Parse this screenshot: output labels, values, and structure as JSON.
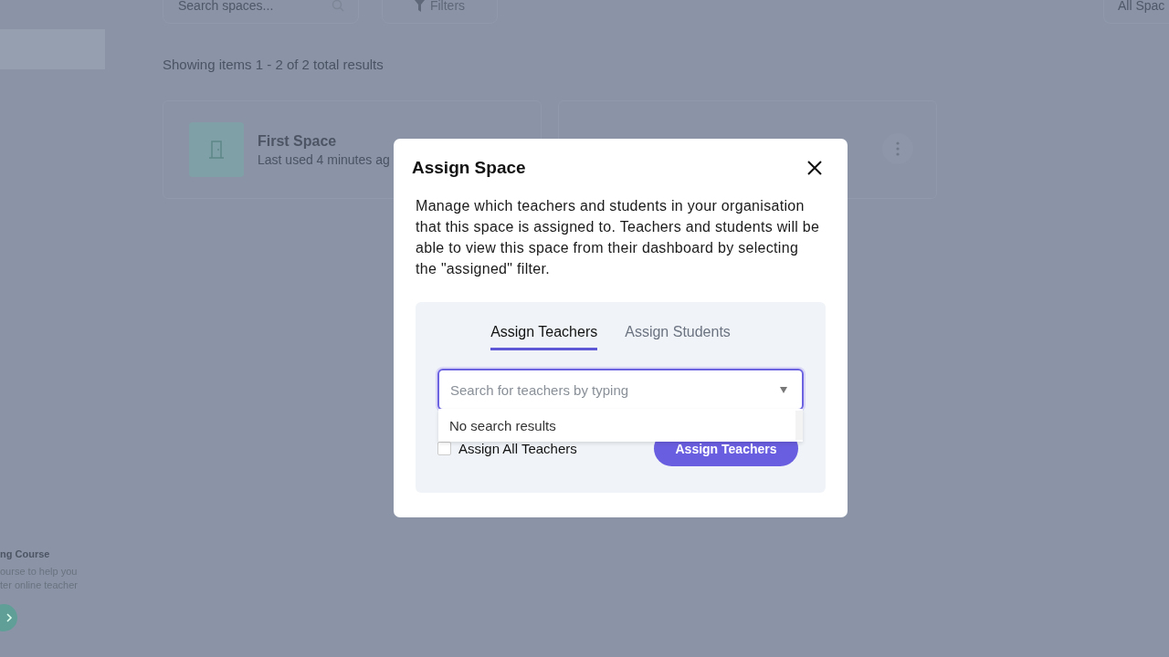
{
  "page": {
    "search": {
      "placeholder": "Search spaces..."
    },
    "filters_button": "Filters",
    "view_select": "All Spac",
    "results_summary": "Showing items 1 - 2 of 2 total results",
    "spaces": [
      {
        "kind": "named",
        "title": "First Space",
        "subtitle": "Last used 4 minutes ag"
      },
      {
        "kind": "covered"
      }
    ],
    "sidebar_promo": {
      "title": "ng Course",
      "lines": [
        "ourse to help you",
        "ter online teacher"
      ]
    }
  },
  "modal": {
    "title": "Assign Space",
    "description": "Manage which teachers and students in your organisation that this space is assigned to. Teachers and students will be able to view this space from their dashboard by selecting the \"assigned\" filter.",
    "tabs": [
      {
        "label": "Assign Teachers",
        "selected": true
      },
      {
        "label": "Assign Students",
        "selected": false
      }
    ],
    "search": {
      "placeholder": "Search for teachers by typing"
    },
    "dropdown": {
      "message": "No search results"
    },
    "assign_all": {
      "label": "Assign All Teachers",
      "checked": false
    },
    "submit_button": "Assign Teachers"
  }
}
